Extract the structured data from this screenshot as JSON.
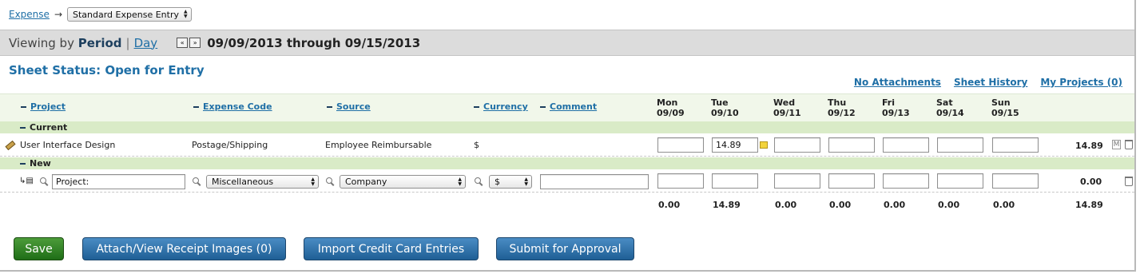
{
  "breadcrumb": {
    "link": "Expense",
    "arrow": "→",
    "selected": "Standard Expense Entry"
  },
  "period": {
    "viewing_by": "Viewing by",
    "period": "Period",
    "sep": "|",
    "day": "Day",
    "prev": "«",
    "next": "»",
    "range": "09/09/2013 through 09/15/2013"
  },
  "status": "Sheet Status: Open for Entry",
  "links": {
    "attachments": "No Attachments",
    "history": "Sheet History",
    "projects": "My Projects (0)"
  },
  "columns": {
    "project": "Project",
    "expense_code": "Expense Code",
    "source": "Source",
    "currency": "Currency",
    "comment": "Comment"
  },
  "days": [
    {
      "name": "Mon",
      "date": "09/09"
    },
    {
      "name": "Tue",
      "date": "09/10"
    },
    {
      "name": "Wed",
      "date": "09/11"
    },
    {
      "name": "Thu",
      "date": "09/12"
    },
    {
      "name": "Fri",
      "date": "09/13"
    },
    {
      "name": "Sat",
      "date": "09/14"
    },
    {
      "name": "Sun",
      "date": "09/15"
    }
  ],
  "sections": {
    "current": "Current",
    "new": "New"
  },
  "current_row": {
    "project": "User Interface Design",
    "expense_code": "Postage/Shipping",
    "source": "Employee Reimbursable",
    "currency": "$",
    "values": [
      "",
      "14.89",
      "",
      "",
      "",
      "",
      ""
    ],
    "total": "14.89",
    "m_label": "M"
  },
  "new_row": {
    "project_value": "Project:",
    "expense_code": "Miscellaneous",
    "source": "Company",
    "currency": "$",
    "values": [
      "",
      "",
      "",
      "",
      "",
      "",
      ""
    ],
    "total": "0.00"
  },
  "totals": {
    "days": [
      "0.00",
      "14.89",
      "0.00",
      "0.00",
      "0.00",
      "0.00",
      "0.00"
    ],
    "grand": "14.89"
  },
  "buttons": {
    "save": "Save",
    "attach": "Attach/View Receipt Images (0)",
    "import": "Import Credit Card Entries",
    "submit": "Submit for Approval"
  },
  "colors": {
    "link": "#1f6fa6",
    "section_bg": "#d9ebc7",
    "save_green": "#2e7f22",
    "button_blue": "#2f6fa7"
  }
}
